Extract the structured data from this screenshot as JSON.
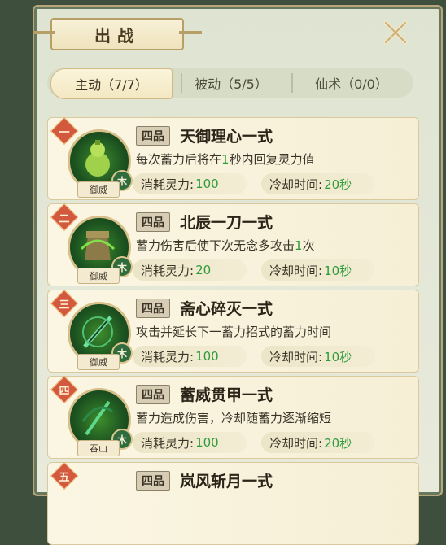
{
  "header": {
    "title": "出战"
  },
  "tabs": [
    {
      "label": "主动（7/7）",
      "active": true
    },
    {
      "label": "被动（5/5）",
      "active": false
    },
    {
      "label": "仙术（0/0）",
      "active": false
    }
  ],
  "cost_label": "消耗灵力:",
  "cooldown_label": "冷却时间:",
  "skills": [
    {
      "rank": "一",
      "grade": "四品",
      "name": "天御理心一式",
      "desc_pre": "每次蓄力后将在",
      "desc_hl": "1",
      "desc_post": "秒内回复灵力值",
      "cost": "100",
      "cooldown": "20秒",
      "element": "木",
      "school": "御威"
    },
    {
      "rank": "二",
      "grade": "四品",
      "name": "北辰一刀一式",
      "desc_pre": "蓄力伤害后使下次无念多攻击",
      "desc_hl": "1",
      "desc_post": "次",
      "cost": "20",
      "cooldown": "10秒",
      "element": "木",
      "school": "御威"
    },
    {
      "rank": "三",
      "grade": "四品",
      "name": "斋心碎灭一式",
      "desc_pre": "攻击并延长下一蓄力招式的蓄力时间",
      "desc_hl": "",
      "desc_post": "",
      "cost": "100",
      "cooldown": "10秒",
      "element": "木",
      "school": "御威"
    },
    {
      "rank": "四",
      "grade": "四品",
      "name": "蓄威贯甲一式",
      "desc_pre": "蓄力造成伤害，冷却随蓄力逐渐缩短",
      "desc_hl": "",
      "desc_post": "",
      "cost": "100",
      "cooldown": "20秒",
      "element": "木",
      "school": "吞山"
    },
    {
      "rank": "五",
      "grade": "四品",
      "name": "岚风斩月一式",
      "desc_pre": "",
      "desc_hl": "",
      "desc_post": "",
      "cost": "",
      "cooldown": "",
      "element": "",
      "school": ""
    }
  ]
}
